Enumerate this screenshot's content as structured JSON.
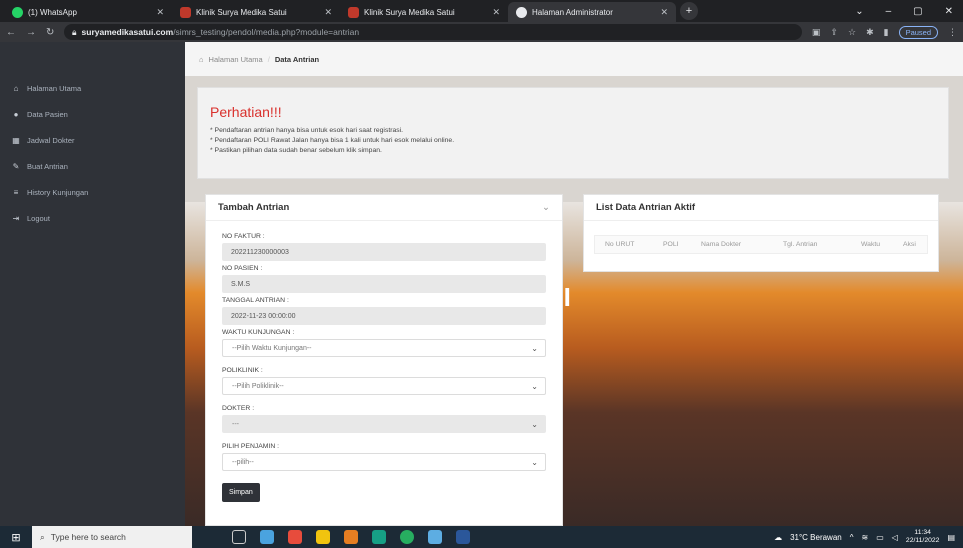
{
  "browser": {
    "tabs": [
      {
        "label": "(1) WhatsApp",
        "icon": "whatsapp-icon",
        "color": "#25d366"
      },
      {
        "label": "Klinik Surya Medika Satui",
        "icon": "clinic-favicon-icon",
        "color": "#c0392b"
      },
      {
        "label": "Klinik Surya Medika Satui",
        "icon": "clinic-favicon-icon",
        "color": "#c0392b"
      },
      {
        "label": "Halaman Administrator",
        "icon": "globe-icon",
        "color": "#e8eaed"
      }
    ],
    "url_host": "suryamedikasatui.com",
    "url_path": "/simrs_testing/pendol/media.php?module=antrian",
    "paused_label": "Paused"
  },
  "sidebar": {
    "items": [
      {
        "label": "Halaman Utama",
        "icon": "home-icon",
        "glyph": "⌂"
      },
      {
        "label": "Data Pasien",
        "icon": "user-icon",
        "glyph": "●"
      },
      {
        "label": "Jadwal Dokter",
        "icon": "calendar-icon",
        "glyph": "▦"
      },
      {
        "label": "Buat Antrian",
        "icon": "pencil-icon",
        "glyph": "✎"
      },
      {
        "label": "History Kunjungan",
        "icon": "list-icon",
        "glyph": "≡"
      },
      {
        "label": "Logout",
        "icon": "logout-icon",
        "glyph": "⇥"
      }
    ]
  },
  "breadcrumb": {
    "home": "Halaman Utama",
    "separator": "/",
    "current": "Data Antrian"
  },
  "alert": {
    "title": "Perhatian!!!",
    "lines": [
      "* Pendaftaran antrian hanya bisa untuk esok hari saat registrasi.",
      "* Pendaftaran POLI Rawat Jalan hanya bisa 1 kali untuk hari esok melalui online.",
      "* Pastikan pilihan data sudah benar sebelum klik simpan."
    ]
  },
  "form": {
    "title": "Tambah Antrian",
    "no_faktur_label": "NO FAKTUR :",
    "no_faktur_value": "202211230000003",
    "no_pasien_label": "NO PASIEN :",
    "no_pasien_value": "S.M.S",
    "tanggal_label": "TANGGAL ANTRIAN :",
    "tanggal_value": "2022-11-23 00:00:00",
    "waktu_label": "WAKTU KUNJUNGAN :",
    "waktu_value": "--Pilih Waktu Kunjungan--",
    "poli_label": "POLIKLINIK :",
    "poli_value": "--Pilih Poliklinik--",
    "dokter_label": "DOKTER :",
    "dokter_value": "---",
    "penjamin_label": "PILIH PENJAMIN :",
    "penjamin_value": "--pilih--",
    "submit_label": "Simpan"
  },
  "list": {
    "title": "List Data Antrian Aktif",
    "columns": [
      "No URUT",
      "POLI",
      "Nama Dokter",
      "Tgl. Antrian",
      "Waktu",
      "Aksi"
    ]
  },
  "background_sign": "TUI",
  "taskbar": {
    "search_placeholder": "Type here to search",
    "weather": "31°C  Berawan",
    "time": "11:34",
    "date": "22/11/2022"
  }
}
